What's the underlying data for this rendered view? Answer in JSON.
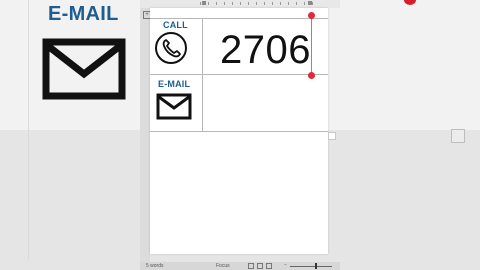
{
  "background": {
    "email_label": "E-MAIL"
  },
  "document": {
    "call_label": "CALL",
    "email_label": "E-MAIL",
    "phone_number": "2706"
  },
  "status_bar": {
    "words": "5 words",
    "focus": "Focus",
    "zoom_minus": "−"
  },
  "icons": {
    "phone": "phone-icon",
    "mail": "envelope-icon"
  },
  "colors": {
    "accent": "#1f5d90",
    "marker": "#e02a3a"
  }
}
